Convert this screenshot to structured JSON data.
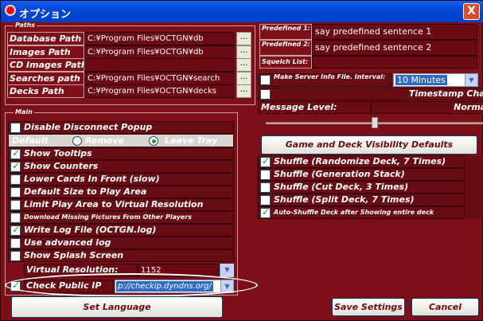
{
  "window": {
    "title": "オプション",
    "close": "X"
  },
  "paths": {
    "group_label": "Paths",
    "rows": [
      {
        "label": "Database Path",
        "value": "C:¥Program Files¥OCTGN¥db",
        "button": "..."
      },
      {
        "label": "Images Path",
        "value": "C:¥Program Files¥OCTGN¥db",
        "button": "..."
      },
      {
        "label": "CD Images Path",
        "value": "",
        "button": "..."
      },
      {
        "label": "Searches path",
        "value": "C:¥Program Files¥OCTGN¥search",
        "button": "..."
      },
      {
        "label": "Decks Path",
        "value": "C:¥Program Files¥OCTGN¥decks",
        "button": "..."
      }
    ]
  },
  "predefined": [
    {
      "label": "Predefined 1:",
      "value": "say predefined sentence 1"
    },
    {
      "label": "Predefined 2:",
      "value": "say predefined sentence 2"
    },
    {
      "label": "Squelch List:",
      "value": ""
    }
  ],
  "server": {
    "make_label": "Make Server Info File. Interval:",
    "interval": "10 Minutes",
    "timestamp": "Timestamp Chat",
    "msg_label": "Message Level:",
    "msg_value": "Normal"
  },
  "main": {
    "group_label": "Main",
    "disable_popup": "Disable Disconnect Popup",
    "radio": {
      "default": "Default",
      "remove": "Remove",
      "leave": "Leave Tray"
    },
    "checks": [
      {
        "label": "Show Tooltips",
        "checked": true
      },
      {
        "label": "Show Counters",
        "checked": true
      },
      {
        "label": "Lower Cards In Front (slow)",
        "checked": false
      },
      {
        "label": "Default Size to Play Area",
        "checked": false
      },
      {
        "label": "Limit Play Area to Virtual Resolution",
        "checked": false
      },
      {
        "label": "Download Missing Pictures From Other Players",
        "checked": false
      },
      {
        "label": "Write Log File (OCTGN.log)",
        "checked": true
      },
      {
        "label": "Use advanced log",
        "checked": false
      },
      {
        "label": "Show Splash Screen",
        "checked": false
      }
    ],
    "virtual_res_label": "Virtual Resolution:",
    "virtual_res_value": "1152",
    "check_ip_label": "Check Public IP",
    "check_ip_value": "p://checkip.dyndns.org/"
  },
  "game_deck_btn": "Game and Deck Visibility Defaults",
  "shuffle": [
    {
      "label": "Shuffle (Randomize Deck, 7 Times)",
      "checked": true
    },
    {
      "label": "Shuffle (Generation Stack)",
      "checked": false
    },
    {
      "label": "Shuffle (Cut Deck, 3 Times)",
      "checked": false
    },
    {
      "label": "Shuffle (Split Deck, 7 Times)",
      "checked": false
    },
    {
      "label": "Auto-Shuffle Deck after Showing entire deck",
      "checked": true
    }
  ],
  "buttons": {
    "set_language": "Set Language",
    "save": "Save Settings",
    "cancel": "Cancel"
  },
  "slider": {
    "level": 0.5
  }
}
